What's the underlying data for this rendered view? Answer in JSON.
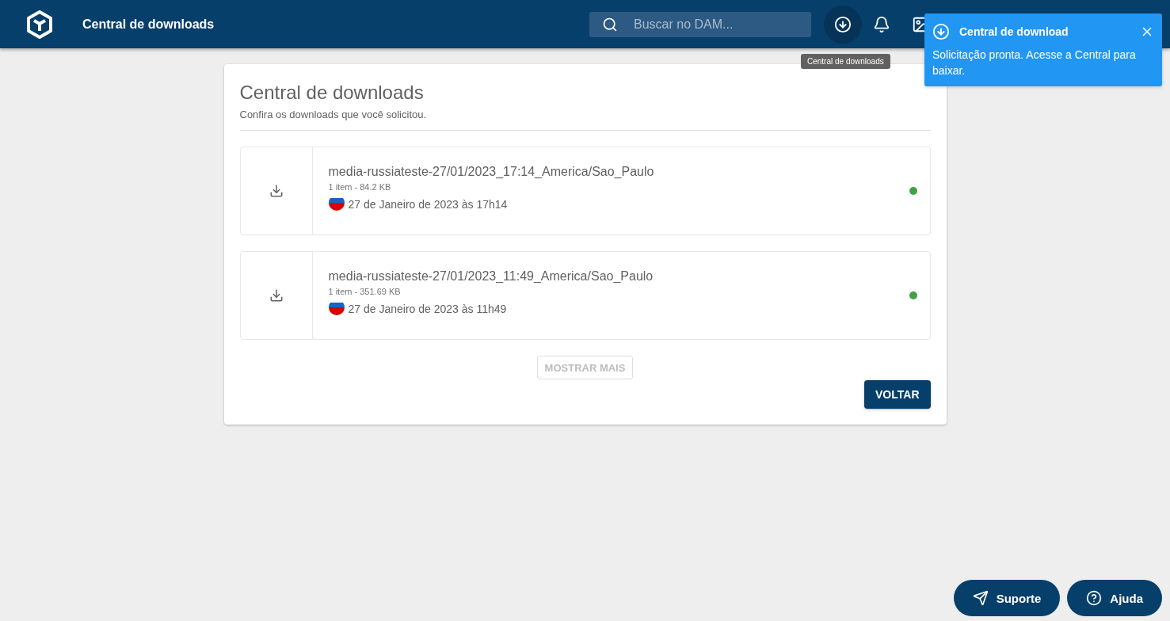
{
  "header": {
    "title": "Central de downloads",
    "search": {
      "placeholder": "Buscar no DAM..."
    },
    "icons": [
      {
        "kind": "download",
        "selected": true
      },
      {
        "kind": "bell",
        "selected": false
      },
      {
        "kind": "image",
        "selected": false
      }
    ],
    "tooltip": "Central de downloads"
  },
  "toast": {
    "title": "Central de download",
    "message": "Solicitação pronta. Acesse a Central para baixar."
  },
  "card": {
    "title": "Central de downloads",
    "subtitle": "Confira os downloads que você solicitou.",
    "downloads": [
      {
        "name": "media-russiateste-27/01/2023_17:14_America/Sao_Paulo",
        "meta": "1 item - 84.2 KB",
        "date": "27 de Janeiro de 2023 às 17h14",
        "color": "#43a047"
      },
      {
        "name": "media-russiateste-27/01/2023_11:49_America/Sao_Paulo",
        "meta": "1 item - 351.69 KB",
        "date": "27 de Janeiro de 2023 às 11h49",
        "color": "#43a047"
      }
    ],
    "more_button": {
      "label": "MOSTRAR MAIS",
      "disabled": true
    },
    "back_button": "VOLTAR"
  },
  "fab": [
    {
      "kind": "send",
      "label": "Suporte"
    },
    {
      "kind": "help",
      "label": "Ajuda"
    }
  ]
}
